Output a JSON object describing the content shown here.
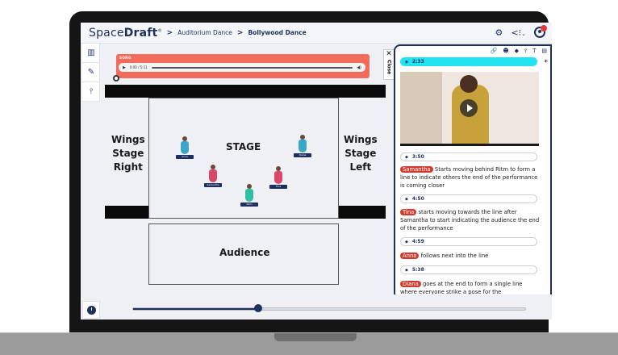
{
  "app": {
    "logo_light": "Space",
    "logo_bold": "Draft",
    "logo_mark": "®",
    "breadcrumb": [
      "Auditorium Dance",
      "Bollywood Dance"
    ],
    "breadcrumb_separator": ">"
  },
  "toolbar_icons": [
    "gear-icon",
    "share-icon",
    "chevron-down-icon",
    "user-avatar-icon"
  ],
  "left_tools": [
    "map-icon",
    "pencil-icon",
    "pin-icon"
  ],
  "audio": {
    "label": "SONG",
    "time": "0:00 / 5:11",
    "play_icon": "▶",
    "volume_icon": "◀)"
  },
  "stage": {
    "title": "STAGE",
    "wings_right": [
      "Wings",
      "Stage",
      "Right"
    ],
    "wings_left": [
      "Wings",
      "Stage",
      "Left"
    ],
    "audience": "Audience",
    "dancers": [
      {
        "name": "Anna",
        "color": "#3aa7c9"
      },
      {
        "name": "Diana",
        "color": "#3aa7c9"
      },
      {
        "name": "Samantha",
        "color": "#d9486a"
      },
      {
        "name": "Tina",
        "color": "#d9486a"
      },
      {
        "name": "Ritm",
        "color": "#2fbfa4"
      }
    ]
  },
  "timeline": {
    "progress": 0.32
  },
  "panel": {
    "close_label": "Close",
    "close_icon": "✕",
    "tool_icons": [
      "🔗",
      "☻",
      "◆",
      "⫯",
      "T",
      "▤"
    ],
    "asterisk": "*",
    "active_time": "2:33",
    "entries": [
      {
        "time": "3:50",
        "name": "Samantha",
        "text": "Starts moving behind Ritm to form a line to indicate others the end of the performance is coming closer"
      },
      {
        "time": "4:50",
        "name": "Tina",
        "text": "starts moving towards the line after Samantha to start indicating the audience the end of the performance"
      },
      {
        "time": "4:59",
        "name": "Anna",
        "text": "follows next into the line"
      },
      {
        "time": "5:38",
        "name": "Diana",
        "text": "goes at the end to form a single line where everyone strike a pose for the"
      }
    ]
  },
  "colors": {
    "brand": "#1e2f5e",
    "audio_bg": "#f26b5b",
    "active_time_bg": "#22e3f2",
    "name_pill": "#d23a2e"
  }
}
